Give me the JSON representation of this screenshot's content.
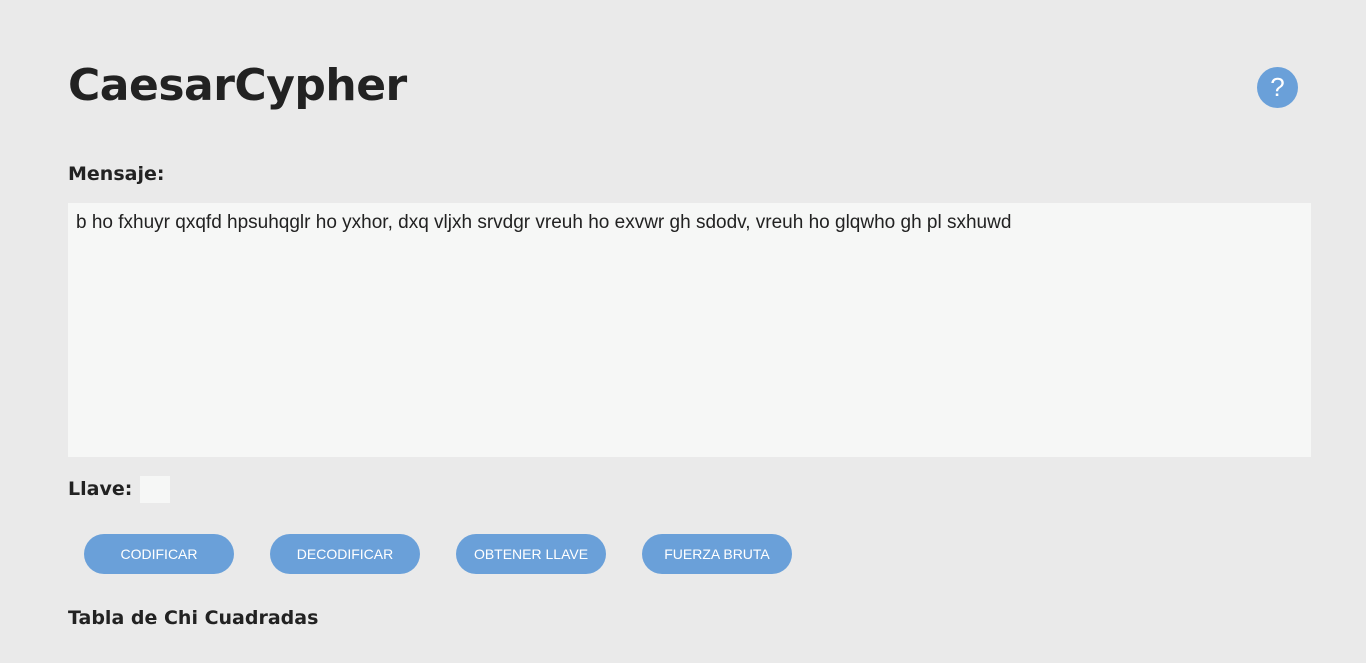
{
  "header": {
    "title": "CaesarCypher",
    "help_label": "?"
  },
  "message": {
    "label": "Mensaje:",
    "value": "b ho fxhuyr qxqfd hpsuhqglr ho yxhor, dxq vljxh srvdgr vreuh ho exvwr gh sdodv, vreuh ho glqwho gh pl sxhuwd"
  },
  "key": {
    "label": "Llave:",
    "value": ""
  },
  "actions": {
    "encode": "CODIFICAR",
    "decode": "DECODIFICAR",
    "get_key": "OBTENER LLAVE",
    "brute_force": "FUERZA BRUTA"
  },
  "chi_table": {
    "title": "Tabla de Chi Cuadradas"
  },
  "colors": {
    "background": "#eaeaea",
    "accent": "#6aa0d9",
    "input_background": "#f6f7f6",
    "text": "#222222"
  }
}
